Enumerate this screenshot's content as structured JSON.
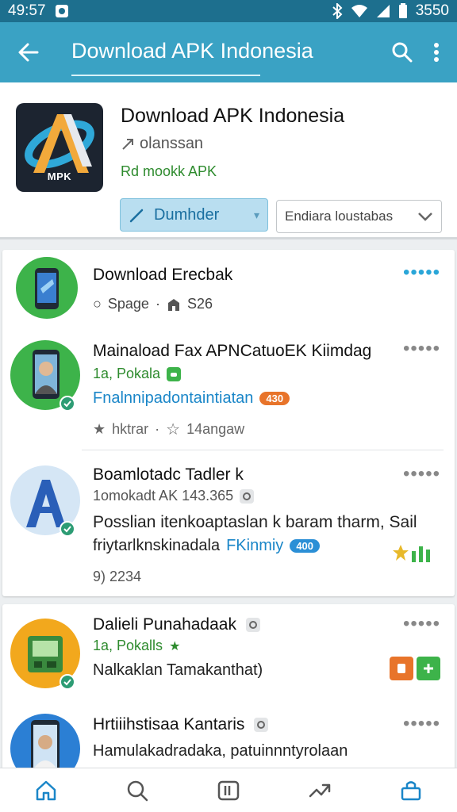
{
  "status_bar": {
    "time": "49:57",
    "right_text": "3550"
  },
  "app_bar": {
    "title": "Download APK Indonesia"
  },
  "header": {
    "logo_text": "MPK",
    "title": "Download APK Indonesia",
    "subtitle": "olanssan",
    "tag": "Rd mookk APK",
    "primary_button": "Dumhder",
    "select_value": "Endiara loustabas"
  },
  "items": [
    {
      "title": "Download Erecbak",
      "line1_a": "Spage",
      "line1_b": "S26"
    },
    {
      "title": "Mainaload Fax APNCatuoEK Kiimdag",
      "line1": "1a, Pokala",
      "line2": "Fnalnnipadontaintiatan",
      "pill": "430",
      "line3_a": "hktrar",
      "line3_b": "14angaw"
    },
    {
      "title": "Boamlotadc Tadler k",
      "line1": "1omokadt AK 143.365",
      "line2": "Posslian itenkoaptaslan k baram tharm, Sail",
      "line3": "friytarlknskinadala",
      "line3_link": "FKinmiy",
      "pill": "400",
      "line4": "9) 2234"
    },
    {
      "title": "Dalieli Punahadaak",
      "line1": "1a, Pokalls",
      "line2": "Nalkaklan Tamakanthat)"
    },
    {
      "title": "Hrtiiihstisaa Kantaris",
      "line1": "Hamulakadradaka, patuinnntyrolaan"
    }
  ],
  "colors": {
    "app_bar": "#3aa2c4",
    "status_bar": "#1d6f8e",
    "accent_green": "#2e8b2e",
    "accent_blue": "#1a86c8",
    "nav_active": "#1a86c8"
  },
  "bottom_nav": [
    "home-icon",
    "search-icon",
    "library-icon",
    "transfer-icon",
    "store-icon"
  ]
}
